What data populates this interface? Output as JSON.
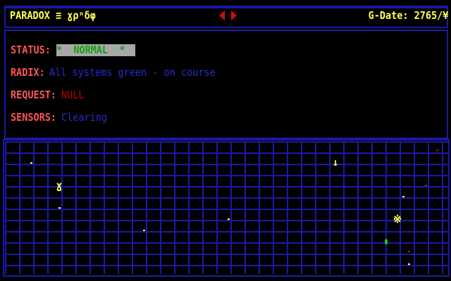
{
  "header": {
    "title": "PARADOX ≡ ɣρⁿδφ",
    "date_label": "G-Date:",
    "date_value": "2765/¥",
    "nav_prev_icon": "red-left-triangle",
    "nav_next_icon": "red-right-triangle"
  },
  "status_panel": {
    "status_label": "STATUS:",
    "status_value": "*  NORMAL  *",
    "radix_label": "RADIX:",
    "radix_value": "All systems green - on course",
    "request_label": "REQUEST:",
    "request_value": "NULL",
    "sensors_label": "SENSORS:",
    "sensors_value": "Clearing"
  },
  "map": {
    "grid_color": "#1a1aa8",
    "objects": [
      {
        "kind": "player-ship",
        "glyph": "ɣ",
        "color": "#ffff55"
      },
      {
        "kind": "arrow-marker",
        "glyph": "↓",
        "color": "#ffff55"
      },
      {
        "kind": "station",
        "glyph": "※",
        "color": "#ffff55"
      },
      {
        "kind": "green-ship",
        "glyph": "",
        "color": "#22cc22"
      }
    ]
  }
}
